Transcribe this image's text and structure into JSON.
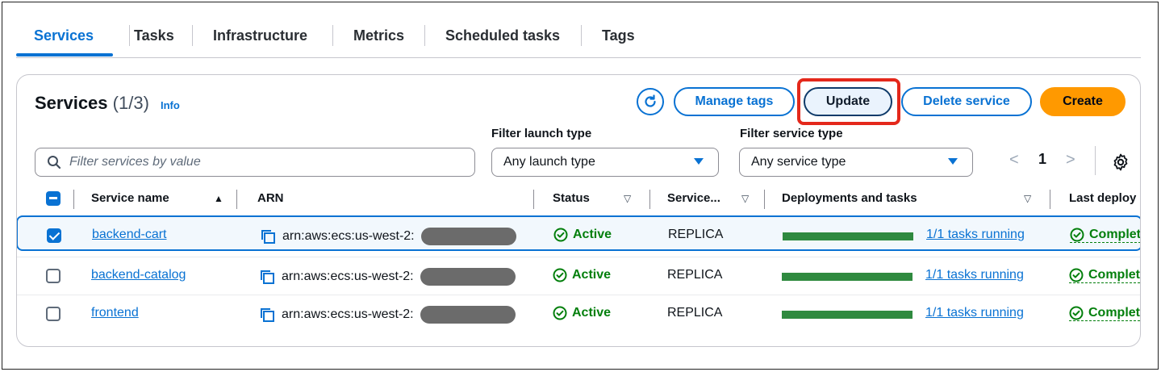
{
  "tabs": [
    {
      "label": "Services",
      "active": true
    },
    {
      "label": "Tasks"
    },
    {
      "label": "Infrastructure"
    },
    {
      "label": "Metrics"
    },
    {
      "label": "Scheduled tasks"
    },
    {
      "label": "Tags"
    }
  ],
  "panel": {
    "title": "Services",
    "count": "(1/3)",
    "info": "Info"
  },
  "actions": {
    "refresh_icon": "refresh-icon",
    "manage_tags": "Manage tags",
    "update": "Update",
    "delete_service": "Delete service",
    "create": "Create"
  },
  "filters": {
    "search_placeholder": "Filter services by value",
    "launch_type_label": "Filter launch type",
    "launch_type_value": "Any launch type",
    "service_type_label": "Filter service type",
    "service_type_value": "Any service type"
  },
  "pagination": {
    "prev": "<",
    "page": "1",
    "next": ">"
  },
  "columns": {
    "service_name": "Service name",
    "arn": "ARN",
    "status": "Status",
    "service_type": "Service...",
    "deployments": "Deployments and tasks",
    "last_deploy": "Last deploy"
  },
  "rows": [
    {
      "name": "backend-cart",
      "arn": "arn:aws:ecs:us-west-2:",
      "status": "Active",
      "service_type": "REPLICA",
      "tasks": "1/1 tasks running",
      "tasks_progress": 1.0,
      "last_deploy": "Complet",
      "checked": true
    },
    {
      "name": "backend-catalog",
      "arn": "arn:aws:ecs:us-west-2:",
      "status": "Active",
      "service_type": "REPLICA",
      "tasks": "1/1 tasks running",
      "tasks_progress": 1.0,
      "last_deploy": "Complet",
      "checked": false
    },
    {
      "name": "frontend",
      "arn": "arn:aws:ecs:us-west-2:",
      "status": "Active",
      "service_type": "REPLICA",
      "tasks": "1/1 tasks running",
      "tasks_progress": 1.0,
      "last_deploy": "Complet",
      "checked": false
    }
  ],
  "colors": {
    "accent": "#0972d3",
    "primary": "#ff9900",
    "success": "#037f0c",
    "highlight": "#e4281b"
  }
}
